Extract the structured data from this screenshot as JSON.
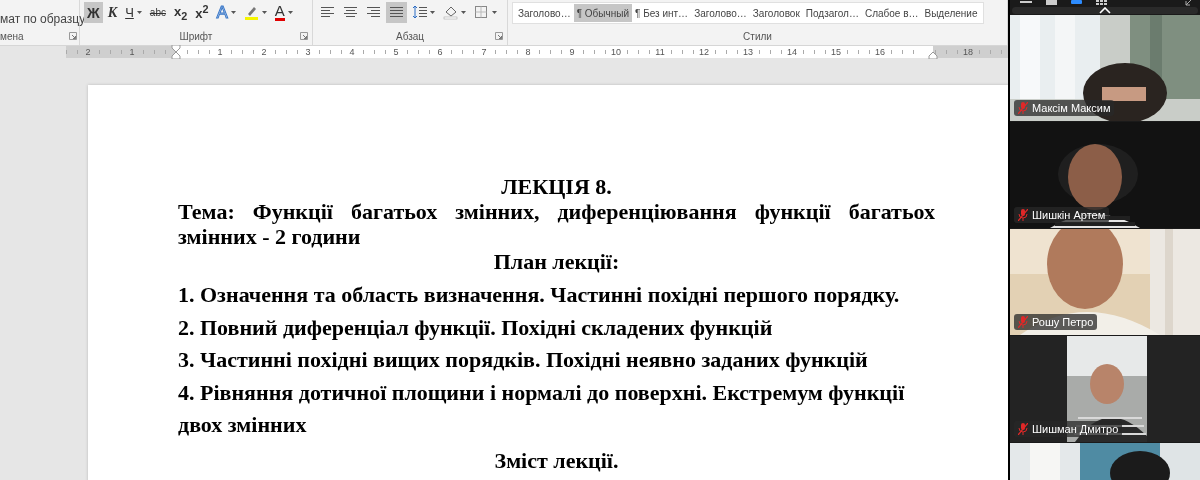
{
  "ribbon": {
    "groups": [
      {
        "label": "мена",
        "buttons": [
          {
            "kind": "text",
            "label": "мат по образцу",
            "selected": false,
            "dropdown": false
          }
        ]
      },
      {
        "label": "Шрифт",
        "buttons": [
          {
            "kind": "bold",
            "label": "Ж",
            "selected": true,
            "dropdown": false
          },
          {
            "kind": "italic",
            "label": "К",
            "selected": false,
            "dropdown": false
          },
          {
            "kind": "underline",
            "label": "Ч",
            "selected": false,
            "dropdown": true
          },
          {
            "kind": "strike",
            "label": "abc",
            "selected": false,
            "dropdown": false
          },
          {
            "kind": "subscript",
            "label": "x$_{2}$",
            "selected": false,
            "dropdown": false
          },
          {
            "kind": "superscript",
            "label": "x$^{2}$",
            "selected": false,
            "dropdown": false
          },
          {
            "kind": "effects",
            "label": "A",
            "selected": false,
            "dropdown": true
          },
          {
            "kind": "highlight",
            "selected": false,
            "dropdown": true
          },
          {
            "kind": "fontcolor",
            "label": "A",
            "selected": false,
            "dropdown": true
          }
        ]
      },
      {
        "label": "Абзац",
        "buttons": [
          {
            "kind": "align-left",
            "selected": false,
            "dropdown": false
          },
          {
            "kind": "align-center",
            "selected": false,
            "dropdown": false
          },
          {
            "kind": "align-right",
            "selected": false,
            "dropdown": false
          },
          {
            "kind": "justify",
            "selected": true,
            "dropdown": false
          },
          {
            "kind": "line-spacing",
            "selected": false,
            "dropdown": true
          },
          {
            "kind": "shading",
            "selected": false,
            "dropdown": true
          },
          {
            "kind": "borders",
            "selected": false,
            "dropdown": true
          }
        ]
      },
      {
        "label": "Стили",
        "styles": [
          {
            "label": "Заголово…",
            "selected": false
          },
          {
            "label": "¶ Обычный",
            "selected": true
          },
          {
            "label": "¶ Без инт…",
            "selected": false
          },
          {
            "label": "Заголово…",
            "selected": false
          },
          {
            "label": "Заголовок",
            "selected": false
          },
          {
            "label": "Подзагол…",
            "selected": false
          },
          {
            "label": "Слабое в…",
            "selected": false
          },
          {
            "label": "Выделение",
            "selected": false
          }
        ]
      }
    ]
  },
  "ruler": {
    "left_marks": [
      "2",
      "1"
    ],
    "marks": [
      "1",
      "2",
      "3",
      "4",
      "5",
      "6",
      "7",
      "8",
      "9",
      "10",
      "11",
      "12",
      "13",
      "14",
      "15",
      "16"
    ],
    "right_marks": [
      "18"
    ]
  },
  "document": {
    "blocks": [
      {
        "kind": "title",
        "text": "ЛЕКЦІЯ 8."
      },
      {
        "kind": "topic",
        "text": "Тема: Функції багатьох змінних, диференціювання функції багатьох змінних - 2 години"
      },
      {
        "kind": "title",
        "text": "План лекції:"
      },
      {
        "kind": "item",
        "text": "1. Означення та область визначення. Частинні похідні першого порядку."
      },
      {
        "kind": "item",
        "text": "2. Повний диференціал функції. Похідні складених функцій"
      },
      {
        "kind": "item",
        "text": "3. Частинні похідні вищих порядків. Похідні неявно заданих функцій"
      },
      {
        "kind": "item",
        "text": "4. Рівняння дотичної площини і нормалі до поверхні. Екстремум функції двох змінних"
      },
      {
        "kind": "title",
        "text": "Зміст лекції."
      }
    ]
  },
  "participants": [
    {
      "name": "Максім Максим",
      "muted": true
    },
    {
      "name": "Шишкін Артем",
      "muted": true
    },
    {
      "name": "Рошу Петро",
      "muted": true
    },
    {
      "name": "Шишман Дмитро",
      "muted": true
    }
  ]
}
